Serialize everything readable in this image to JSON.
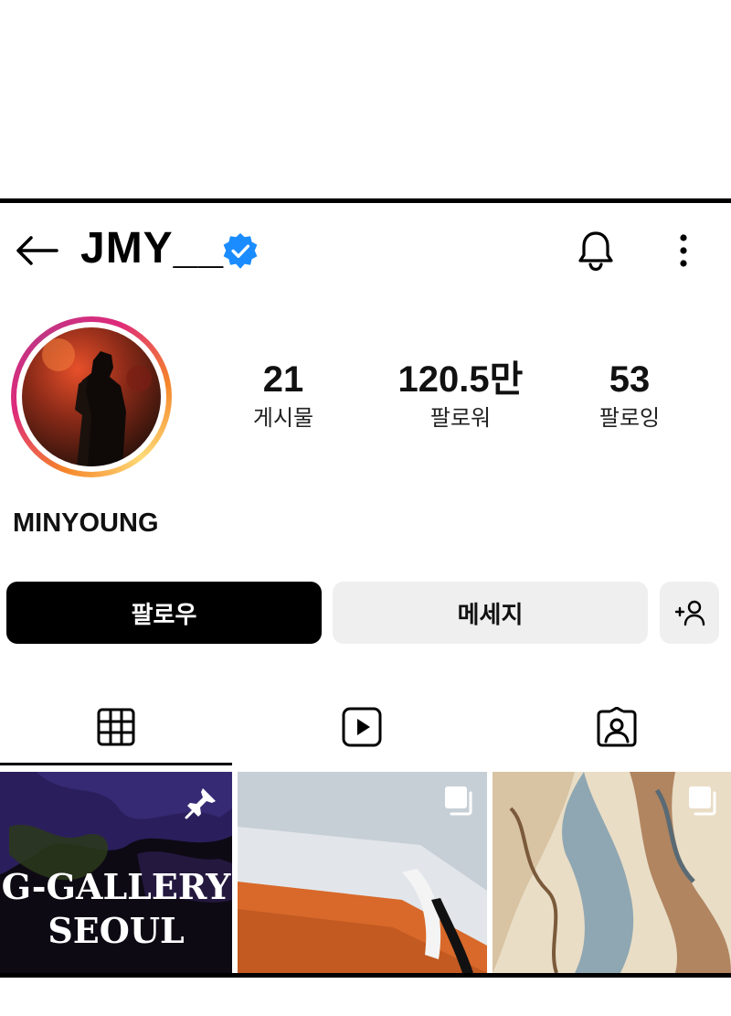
{
  "profile": {
    "username": "JMY__",
    "display_name": "MINYOUNG",
    "verified": true
  },
  "stats": [
    {
      "value": "21",
      "label": "게시물"
    },
    {
      "value": "120.5만",
      "label": "팔로워"
    },
    {
      "value": "53",
      "label": "팔로잉"
    }
  ],
  "actions": {
    "follow": "팔로우",
    "message": "메세지",
    "suggest_icon": "add-person-icon"
  },
  "header_icons": [
    "back-arrow-icon",
    "verified-badge-icon",
    "bell-icon",
    "more-vertical-icon"
  ],
  "tabs": [
    {
      "icon": "grid-icon",
      "selected": true
    },
    {
      "icon": "reels-icon",
      "selected": false
    },
    {
      "icon": "tagged-icon",
      "selected": false
    }
  ],
  "posts": [
    {
      "pinned": true,
      "text_line1": "G-GALLERY",
      "text_line2": "SEOUL",
      "icon": "pin-icon"
    },
    {
      "pinned": false,
      "icon": "carousel-icon"
    },
    {
      "pinned": false,
      "icon": "carousel-icon"
    }
  ],
  "colors": {
    "verified_blue": "#1a8cff",
    "follow_button": "#000000",
    "secondary_button": "#efefef"
  }
}
